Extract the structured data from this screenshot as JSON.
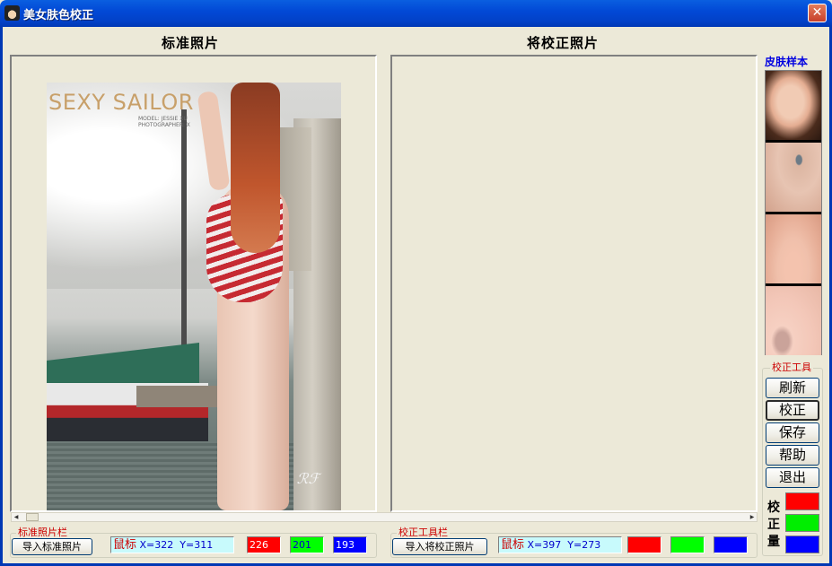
{
  "window": {
    "title": "美女肤色校正",
    "close_glyph": "✕"
  },
  "headings": {
    "standard": "标准照片",
    "target": "将校正照片"
  },
  "photo": {
    "logo_text": "SEXY SAILOR",
    "credit_lines": [
      "MODEL: JESSIE XU",
      "PHOTOGRAPHER: X"
    ],
    "signature": "ℛℱ"
  },
  "skin_samples": {
    "title": "皮肤样本",
    "tiles": [
      "skin-sample-1",
      "skin-sample-2",
      "skin-sample-3",
      "skin-sample-4"
    ]
  },
  "tools": {
    "group_label": "校正工具",
    "buttons": [
      {
        "id": "refresh",
        "label": "刷新"
      },
      {
        "id": "correct",
        "label": "校正",
        "active": true
      },
      {
        "id": "save",
        "label": "保存"
      },
      {
        "id": "help",
        "label": "帮助"
      },
      {
        "id": "exit",
        "label": "退出"
      }
    ],
    "amount_label": [
      "校",
      "正",
      "量"
    ],
    "amount_colors": [
      "#ff0000",
      "#00ee00",
      "#0000ff"
    ]
  },
  "standard_bar": {
    "group_label": "标准照片栏",
    "import_button": "导入标准照片",
    "mouse_label": "鼠标",
    "x_text": "X=322",
    "y_text": "Y=311",
    "r": "226",
    "g": "201",
    "b": "193"
  },
  "correct_bar": {
    "group_label": "校正工具栏",
    "import_button": "导入将校正照片",
    "mouse_label": "鼠标",
    "x_text": "X=397",
    "y_text": "Y=273",
    "r": "",
    "g": "",
    "b": ""
  },
  "colors": {
    "red": "#ff0000",
    "green": "#00ff00",
    "blue": "#0000ff",
    "title_blue": "#0249d6"
  }
}
